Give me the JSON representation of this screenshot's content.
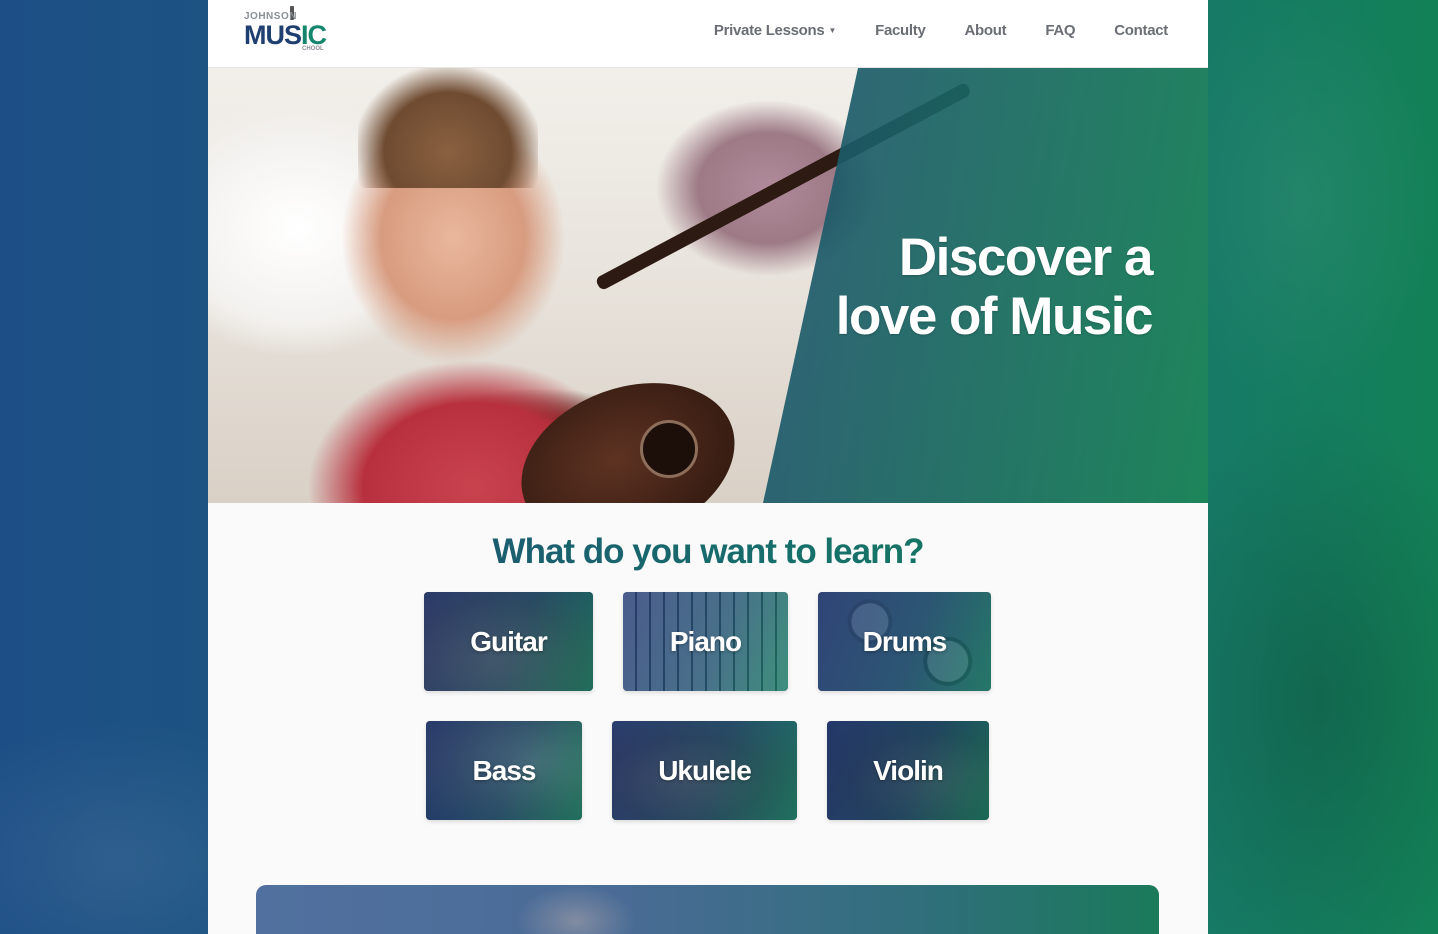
{
  "brand": {
    "logo_top": "JOHNSON",
    "logo_mu": "MU",
    "logo_s": "S",
    "logo_ic": "IC",
    "logo_bottom": "CHOOL",
    "primary_color": "#1f3f70",
    "accent_color": "#138157"
  },
  "nav": {
    "items": [
      {
        "label": "Private Lessons",
        "has_dropdown": true
      },
      {
        "label": "Faculty"
      },
      {
        "label": "About"
      },
      {
        "label": "FAQ"
      },
      {
        "label": "Contact"
      }
    ]
  },
  "hero": {
    "line1": "Discover a",
    "line2": "love of Music"
  },
  "learn": {
    "heading": "What do you want to learn?",
    "instruments": [
      "Guitar",
      "Piano",
      "Drums",
      "Bass",
      "Ukulele",
      "Violin"
    ]
  }
}
